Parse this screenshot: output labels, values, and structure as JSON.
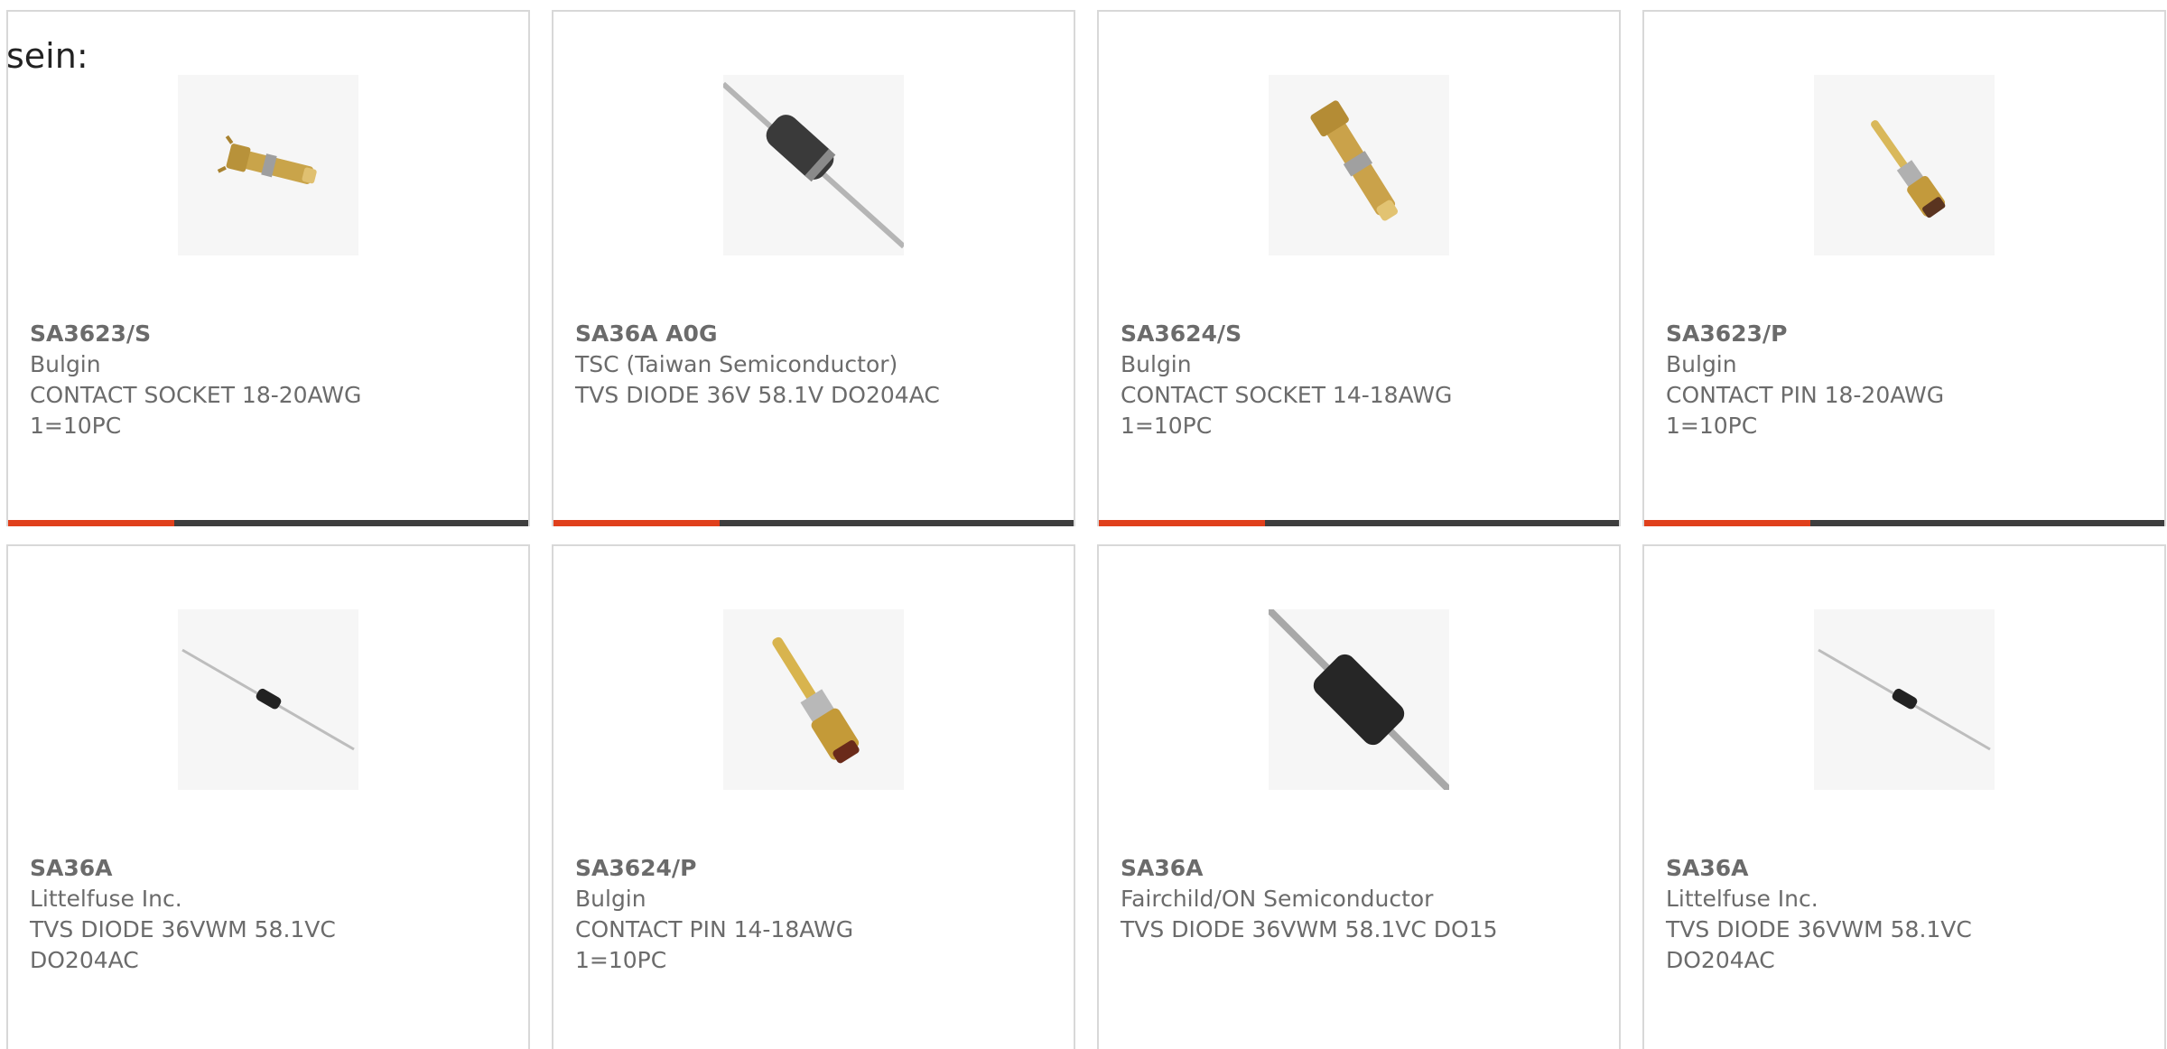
{
  "overlay": {
    "text": "sein:"
  },
  "accent_color": "#e0401c",
  "bar_track_color": "#3e3e3e",
  "cards": [
    {
      "part": "SA3623/S",
      "maker": "Bulgin",
      "line1": "CONTACT SOCKET 18-20AWG",
      "line2": "1=10PC",
      "image_icon": "gold-socket-contact-icon",
      "progress": 0.32
    },
    {
      "part": "SA36A A0G",
      "maker": "TSC (Taiwan Semiconductor)",
      "line1": "TVS DIODE 36V 58.1V DO204AC",
      "line2": "",
      "image_icon": "axial-diode-icon",
      "progress": 0.32
    },
    {
      "part": "SA3624/S",
      "maker": "Bulgin",
      "line1": "CONTACT SOCKET 14-18AWG",
      "line2": "1=10PC",
      "image_icon": "gold-socket-contact-icon",
      "progress": 0.32
    },
    {
      "part": "SA3623/P",
      "maker": "Bulgin",
      "line1": "CONTACT PIN 18-20AWG",
      "line2": "1=10PC",
      "image_icon": "gold-pin-contact-icon",
      "progress": 0.32
    },
    {
      "part": "SA36A",
      "maker": "Littelfuse Inc.",
      "line1": "TVS DIODE 36VWM 58.1VC",
      "line2": "DO204AC",
      "image_icon": "small-axial-diode-icon"
    },
    {
      "part": "SA3624/P",
      "maker": "Bulgin",
      "line1": "CONTACT PIN 14-18AWG",
      "line2": "1=10PC",
      "image_icon": "gold-pin-contact-icon"
    },
    {
      "part": "SA36A",
      "maker": "Fairchild/ON Semiconductor",
      "line1": "TVS DIODE 36VWM 58.1VC DO15",
      "line2": "",
      "image_icon": "axial-diode-icon"
    },
    {
      "part": "SA36A",
      "maker": "Littelfuse Inc.",
      "line1": "TVS DIODE 36VWM 58.1VC",
      "line2": "DO204AC",
      "image_icon": "small-axial-diode-icon"
    }
  ]
}
